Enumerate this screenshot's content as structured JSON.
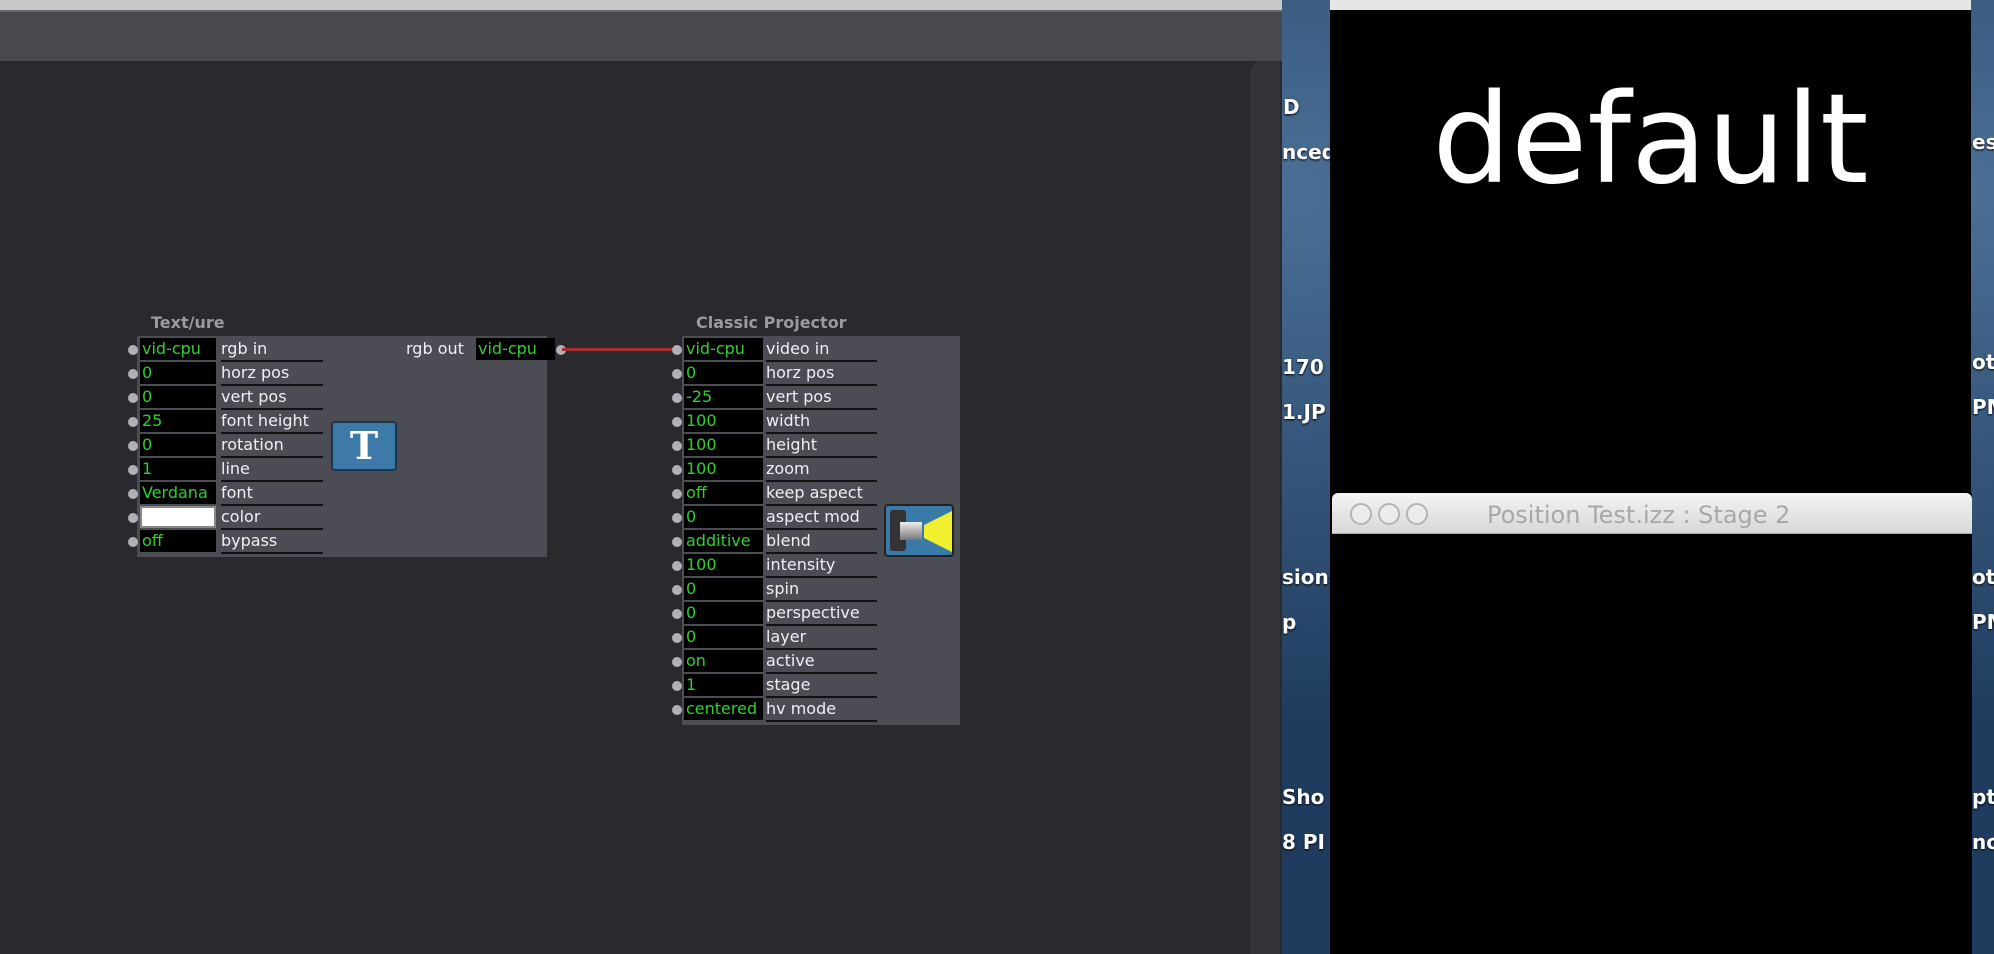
{
  "main_window": {
    "canvas_color": "#2a2a2e"
  },
  "textures_actor": {
    "title": "Text/ure",
    "inputs": [
      {
        "value": "vid-cpu",
        "label": "rgb in"
      },
      {
        "value": "0",
        "label": "horz pos"
      },
      {
        "value": "0",
        "label": "vert pos"
      },
      {
        "value": "25",
        "label": "font height"
      },
      {
        "value": "0",
        "label": "rotation"
      },
      {
        "value": "1",
        "label": "line"
      },
      {
        "value": "Verdana",
        "label": "font"
      },
      {
        "value": "",
        "label": "color",
        "swatch": "#ffffff"
      },
      {
        "value": "off",
        "label": "bypass"
      }
    ],
    "output": {
      "label": "rgb out",
      "value": "vid-cpu"
    },
    "icon": "text-T-icon"
  },
  "projector_actor": {
    "title": "Classic Projector",
    "inputs": [
      {
        "value": "vid-cpu",
        "label": "video in"
      },
      {
        "value": "0",
        "label": "horz pos"
      },
      {
        "value": "-25",
        "label": "vert pos"
      },
      {
        "value": "100",
        "label": "width"
      },
      {
        "value": "100",
        "label": "height"
      },
      {
        "value": "100",
        "label": "zoom"
      },
      {
        "value": "off",
        "label": "keep aspect"
      },
      {
        "value": "0",
        "label": "aspect mod"
      },
      {
        "value": "additive",
        "label": "blend"
      },
      {
        "value": "100",
        "label": "intensity"
      },
      {
        "value": "0",
        "label": "spin"
      },
      {
        "value": "0",
        "label": "perspective"
      },
      {
        "value": "0",
        "label": "layer"
      },
      {
        "value": "on",
        "label": "active"
      },
      {
        "value": "1",
        "label": "stage"
      },
      {
        "value": "centered",
        "label": "hv mode"
      }
    ],
    "icon": "projector-icon"
  },
  "stage1": {
    "text": "default"
  },
  "stage2": {
    "title": "Position Test.izz : Stage 2"
  },
  "desktop_left": [
    "D",
    "nced",
    "170",
    "1.JP",
    "sions",
    "p",
    "Sho",
    "8 PI"
  ],
  "desktop_right": [
    "es",
    "ot",
    "PM",
    "ot",
    "PM",
    "pt",
    "no"
  ],
  "colors": {
    "value_text": "#2fd02f",
    "wire": "#a83030"
  }
}
